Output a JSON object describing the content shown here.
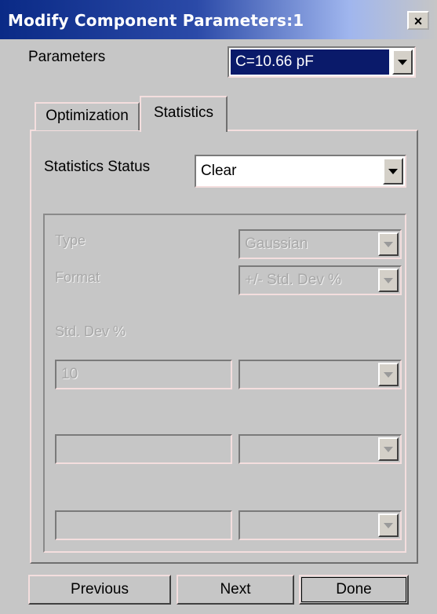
{
  "window": {
    "title": "Modify Component Parameters:1",
    "close_label": "×"
  },
  "parameters": {
    "label": "Parameters",
    "selected": "C=10.66 pF"
  },
  "tabs": [
    {
      "label": "Optimization"
    },
    {
      "label": "Statistics"
    }
  ],
  "statistics": {
    "status_label": "Statistics Status",
    "status_value": "Clear",
    "type_label": "Type",
    "type_value": "Gaussian",
    "format_label": "Format",
    "format_value": "+/- Std. Dev %",
    "stddev_label": "Std. Dev %",
    "rows": [
      {
        "value": "10",
        "unit": ""
      },
      {
        "value": "",
        "unit": ""
      },
      {
        "value": "",
        "unit": ""
      }
    ]
  },
  "buttons": {
    "previous": "Previous",
    "next": "Next",
    "done": "Done"
  },
  "colors": {
    "title_bar": "#0a2a86",
    "selection": "#0a1a6a",
    "dialog": "#c6c6c6"
  },
  "icons": {
    "close": "close-icon",
    "dropdown": "chevron-down-icon"
  }
}
